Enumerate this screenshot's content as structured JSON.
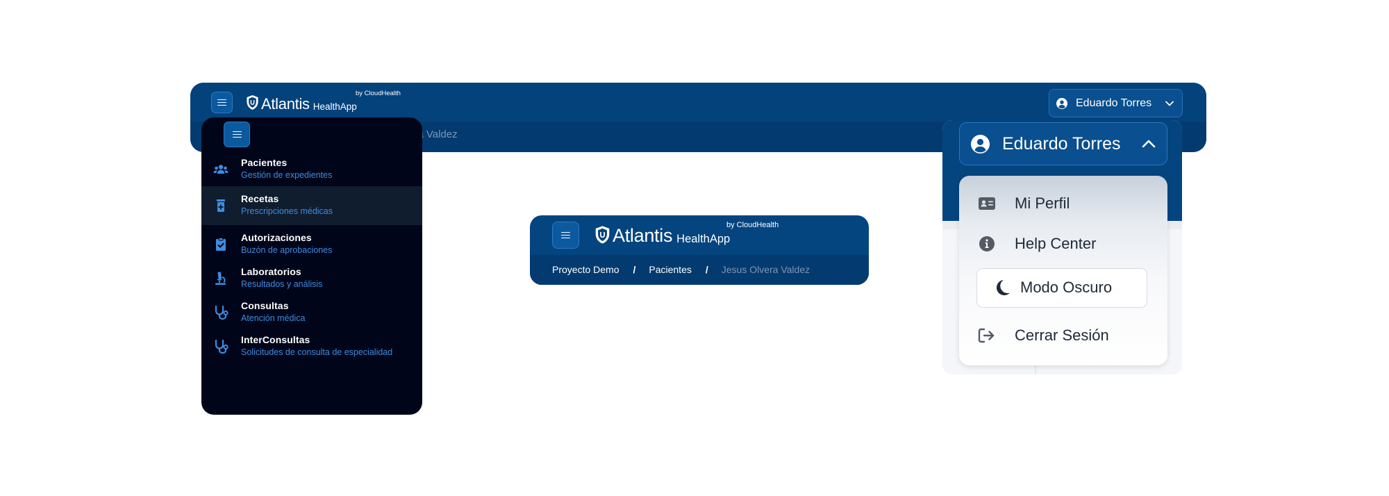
{
  "brand": {
    "name": "Atlantis",
    "app": "HealthApp",
    "by": "by CloudHealth"
  },
  "header": {
    "user_name": "Eduardo Torres",
    "breadcrumb_peek": "era Valdez"
  },
  "sidebar": {
    "items": [
      {
        "label": "Pacientes",
        "sublabel": "Gestión de expedientes",
        "icon": "users-icon"
      },
      {
        "label": "Recetas",
        "sublabel": "Prescripciones médicas",
        "icon": "prescription-bottle-icon",
        "active": true
      },
      {
        "label": "Autorizaciones",
        "sublabel": "Buzón de aprobaciones",
        "icon": "clipboard-check-icon"
      },
      {
        "label": "Laboratorios",
        "sublabel": "Resultados y análisis",
        "icon": "microscope-icon"
      },
      {
        "label": "Consultas",
        "sublabel": "Atención médica",
        "icon": "stethoscope-icon"
      },
      {
        "label": "InterConsultas",
        "sublabel": "Solicitudes de consulta de especialidad",
        "icon": "stethoscope-icon"
      }
    ]
  },
  "breadcrumb": {
    "items": [
      "Proyecto Demo",
      "Pacientes"
    ],
    "separator": "/",
    "current": "Jesus Olvera Valdez"
  },
  "user_menu": {
    "user_name": "Eduardo Torres",
    "items": [
      {
        "label": "Mi Perfil",
        "icon": "id-card-icon"
      },
      {
        "label": "Help Center",
        "icon": "info-circle-icon"
      },
      {
        "label": "Modo Oscuro",
        "icon": "moon-icon"
      },
      {
        "label": "Cerrar Sesión",
        "icon": "sign-out-icon"
      }
    ]
  },
  "colors": {
    "header_blue": "#04457f",
    "sidebar_bg": "#000519",
    "accent_blue": "#3e8de0"
  }
}
